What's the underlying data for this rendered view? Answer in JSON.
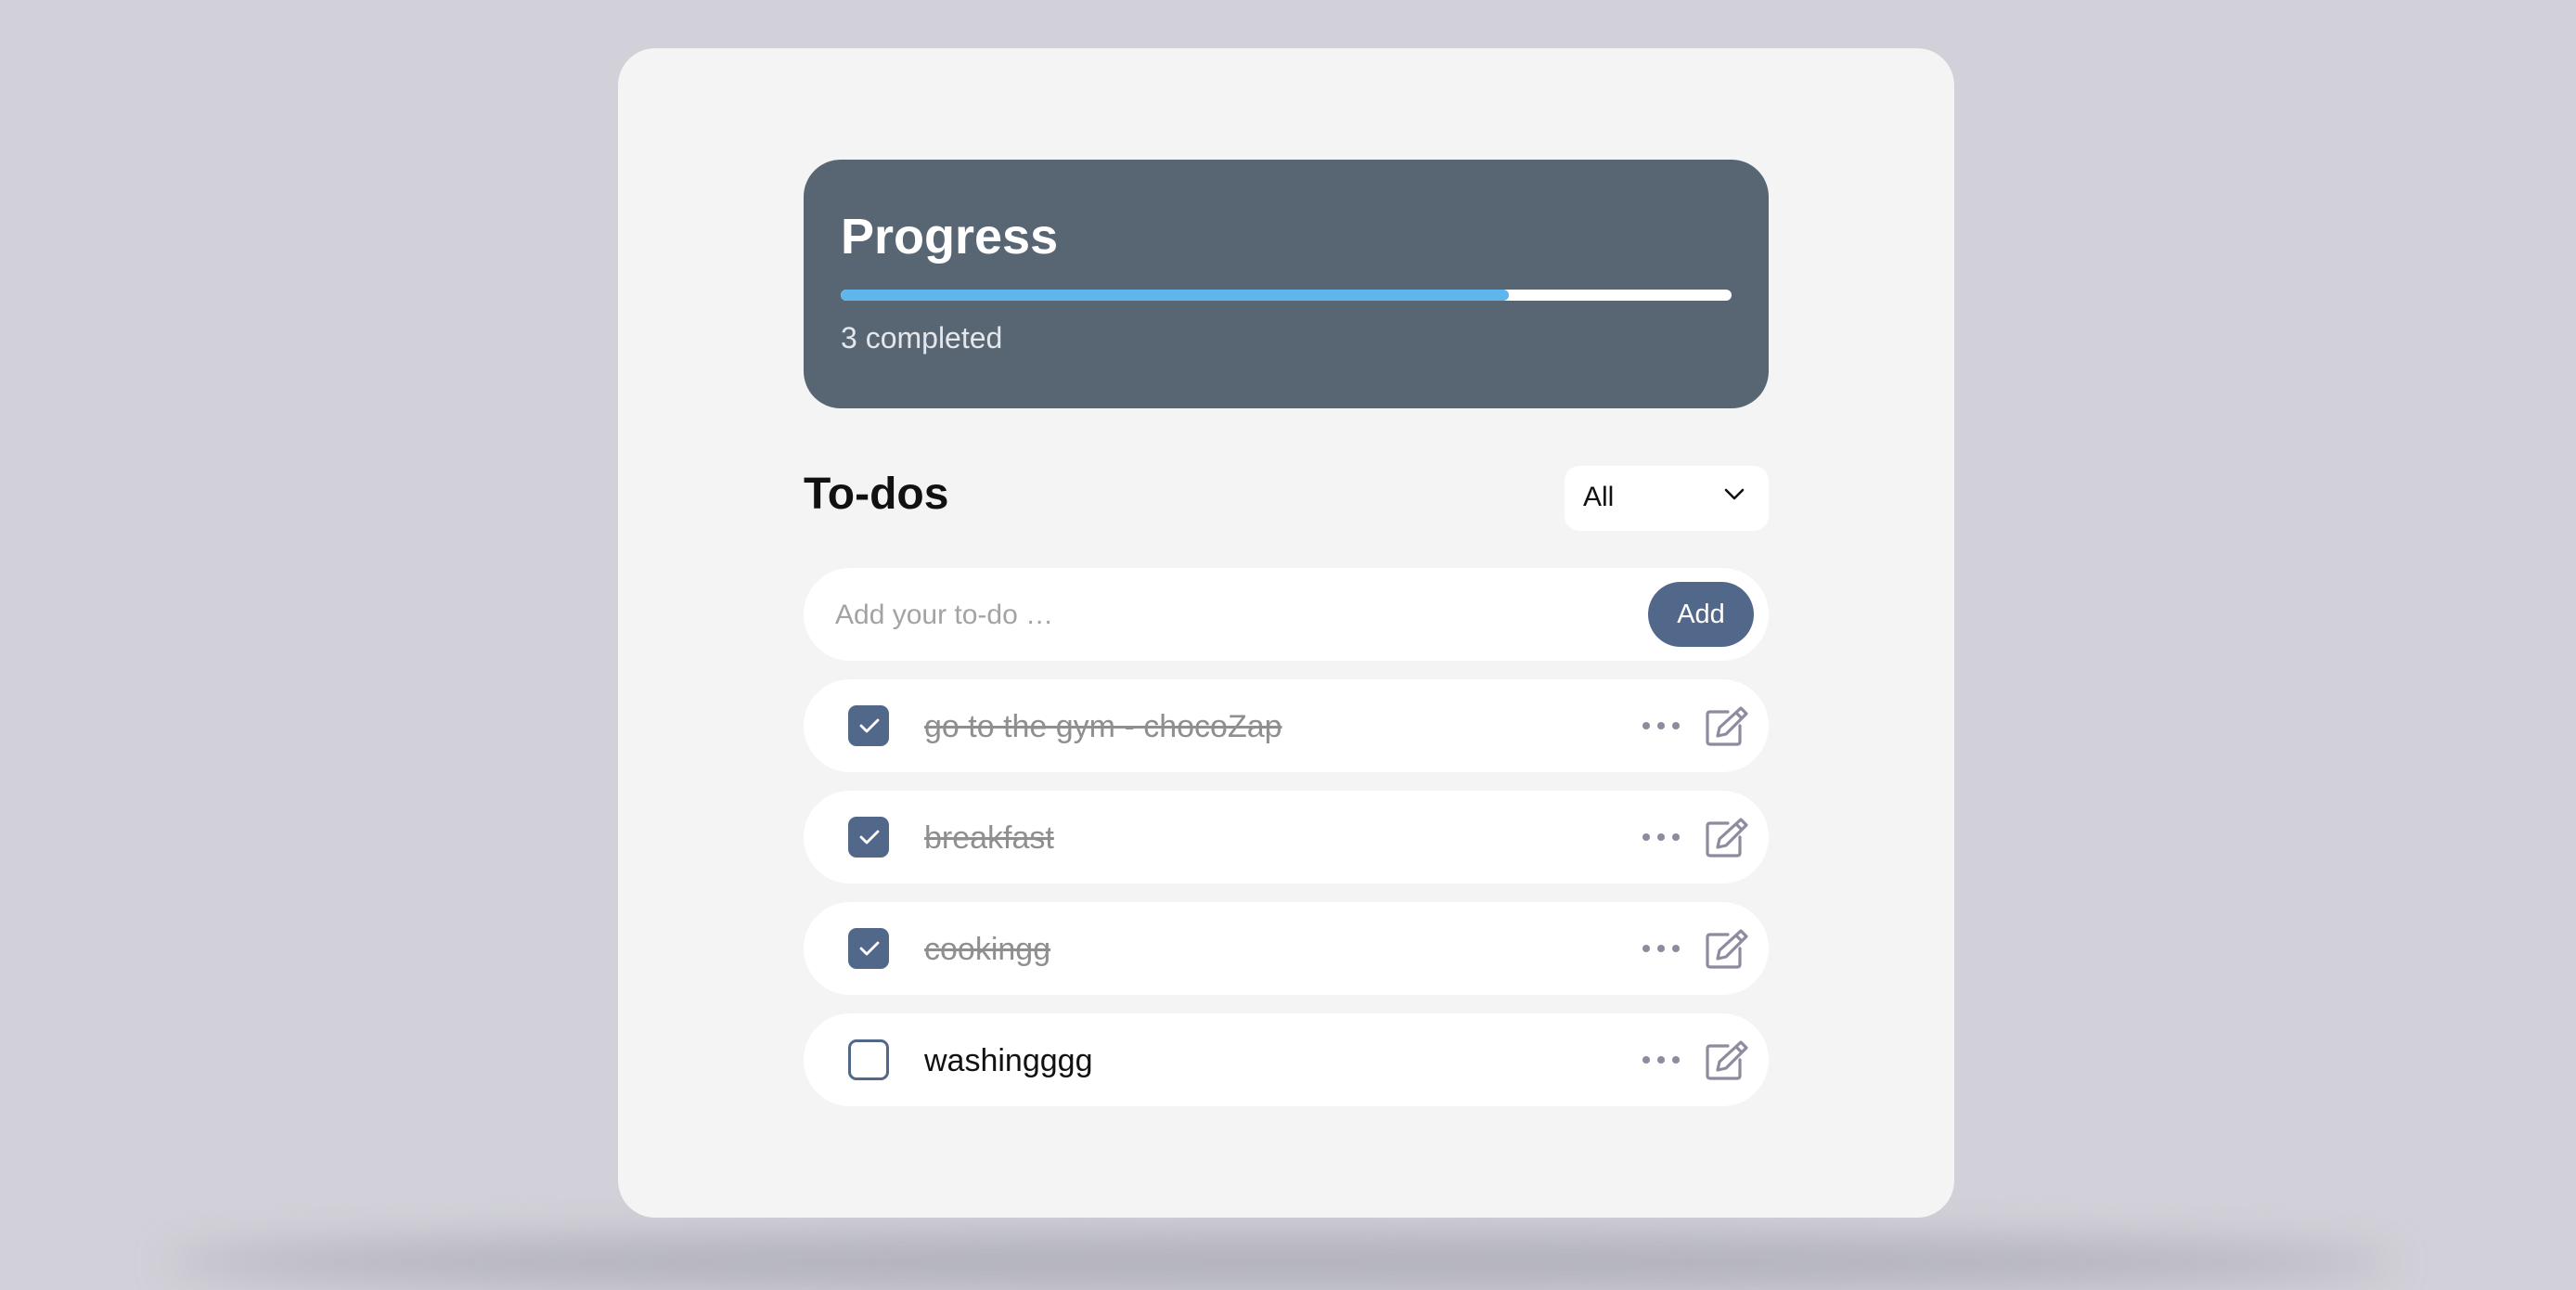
{
  "progress": {
    "title": "Progress",
    "fraction": 0.75,
    "status_text": "3 completed",
    "fill_color": "#5fb6ec",
    "track_color": "#ffffff"
  },
  "todos": {
    "title": "To-dos",
    "filter": {
      "selected": "All"
    },
    "add": {
      "placeholder": "Add your to-do …",
      "button_label": "Add"
    },
    "items": [
      {
        "text": "go to the gym - chocoZap",
        "completed": true
      },
      {
        "text": "breakfast",
        "completed": true
      },
      {
        "text": "cookingg",
        "completed": true
      },
      {
        "text": "washingggg",
        "completed": false
      }
    ]
  },
  "icons": {
    "filter": "chevron-down-icon",
    "check": "check-icon",
    "more": "more-dots-icon",
    "edit": "edit-icon"
  },
  "colors": {
    "background": "#d2d1d9",
    "card": "#f4f4f4",
    "panel": "#586674",
    "accent": "#52688a",
    "icon_gray": "#8f8b9e"
  }
}
